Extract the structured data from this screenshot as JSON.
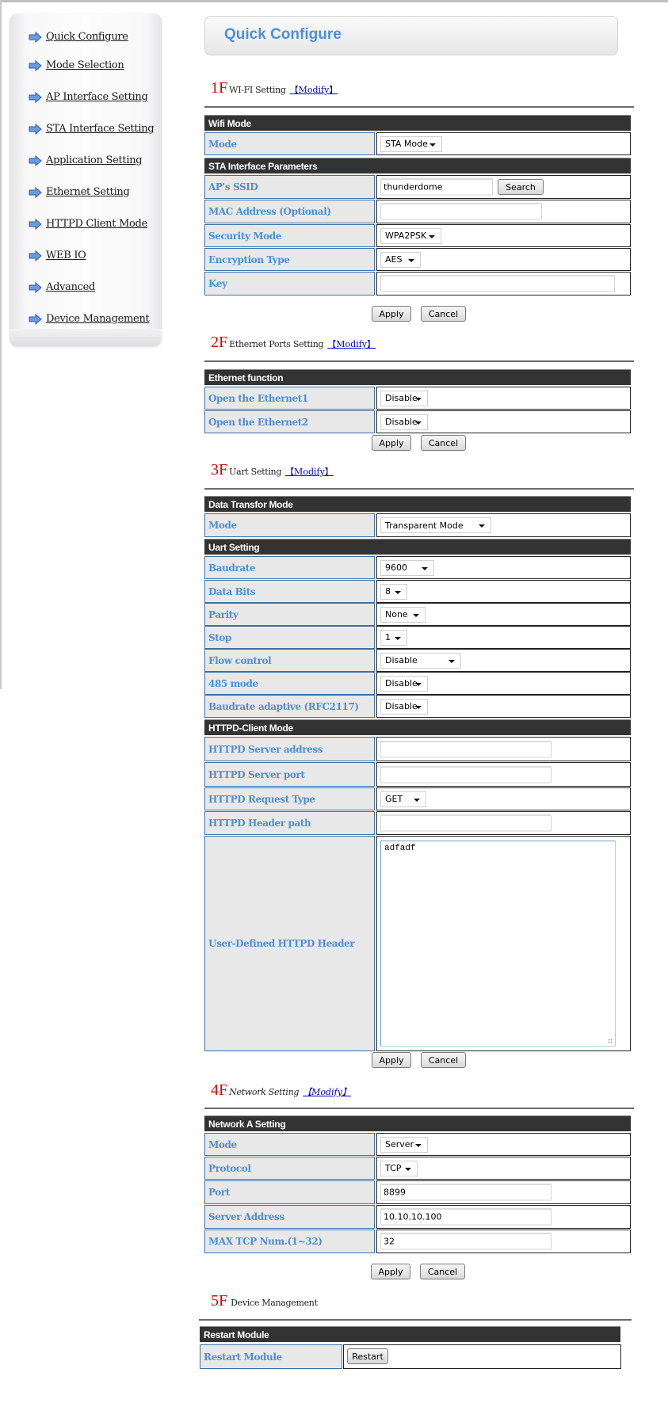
{
  "sidebar": {
    "items": [
      {
        "label": "Quick Configure"
      },
      {
        "label": "Mode Selection"
      },
      {
        "label": "AP Interface Setting"
      },
      {
        "label": "STA Interface Setting"
      },
      {
        "label": "Application Setting"
      },
      {
        "label": "Ethernet Setting"
      },
      {
        "label": "HTTPD Client Mode"
      },
      {
        "label": "WEB IO"
      },
      {
        "label": "Advanced"
      },
      {
        "label": "Device Management"
      }
    ]
  },
  "header": {
    "title": "Quick Configure"
  },
  "common": {
    "modify": "【Modify】",
    "apply": "Apply",
    "cancel": "Cancel"
  },
  "wifi": {
    "num": "1F",
    "title": "WI-FI Setting",
    "bar_mode": "Wifi Mode",
    "mode_label": "Mode",
    "mode_value": "STA Mode",
    "bar_sta": "STA Interface Parameters",
    "ssid_label": "AP's SSID",
    "ssid_value": "thunderdome",
    "search": "Search",
    "mac_label": "MAC Address (Optional)",
    "mac_value": "",
    "security_label": "Security Mode",
    "security_value": "WPA2PSK",
    "encryption_label": "Encryption Type",
    "encryption_value": "AES",
    "key_label": "Key",
    "key_value": ""
  },
  "ethernet": {
    "num": "2F",
    "title": "Ethernet Ports Setting",
    "bar": "Ethernet function",
    "eth1_label": "Open the Ethernet1",
    "eth1_value": "Disable",
    "eth2_label": "Open the Ethernet2",
    "eth2_value": "Disable"
  },
  "uart": {
    "num": "3F",
    "title": "Uart Setting",
    "bar_transfer": "Data Transfor Mode",
    "mode_label": "Mode",
    "mode_value": "Transparent Mode",
    "bar_uart": "Uart Setting",
    "baud_label": "Baudrate",
    "baud_value": "9600",
    "databits_label": "Data Bits",
    "databits_value": "8",
    "parity_label": "Parity",
    "parity_value": "None",
    "stop_label": "Stop",
    "stop_value": "1",
    "flow_label": "Flow control",
    "flow_value": "Disable",
    "rs485_label": "485 mode",
    "rs485_value": "Disable",
    "rfc_label": "Baudrate adaptive (RFC2117)",
    "rfc_value": "Disable",
    "bar_httpd": "HTTPD-Client Mode",
    "httpd_addr_label": "HTTPD Server address",
    "httpd_addr_value": "",
    "httpd_port_label": "HTTPD Server port",
    "httpd_port_value": "",
    "httpd_req_label": "HTTPD Request Type",
    "httpd_req_value": "GET",
    "httpd_path_label": "HTTPD Header path",
    "httpd_path_value": "",
    "httpd_header_label": "User-Defined HTTPD Header",
    "httpd_header_value": "adfadf"
  },
  "network": {
    "num": "4F",
    "title": "Network Setting",
    "bar": "Network A Setting",
    "mode_label": "Mode",
    "mode_value": "Server",
    "protocol_label": "Protocol",
    "protocol_value": "TCP",
    "port_label": "Port",
    "port_value": "8899",
    "server_label": "Server Address",
    "server_value": "10.10.10.100",
    "maxtcp_label": "MAX TCP Num.(1~32)",
    "maxtcp_value": "32"
  },
  "device": {
    "num": "5F",
    "title": "Device Management",
    "bar": "Restart Module",
    "restart_label": "Restart Module",
    "restart_button": "Restart"
  }
}
